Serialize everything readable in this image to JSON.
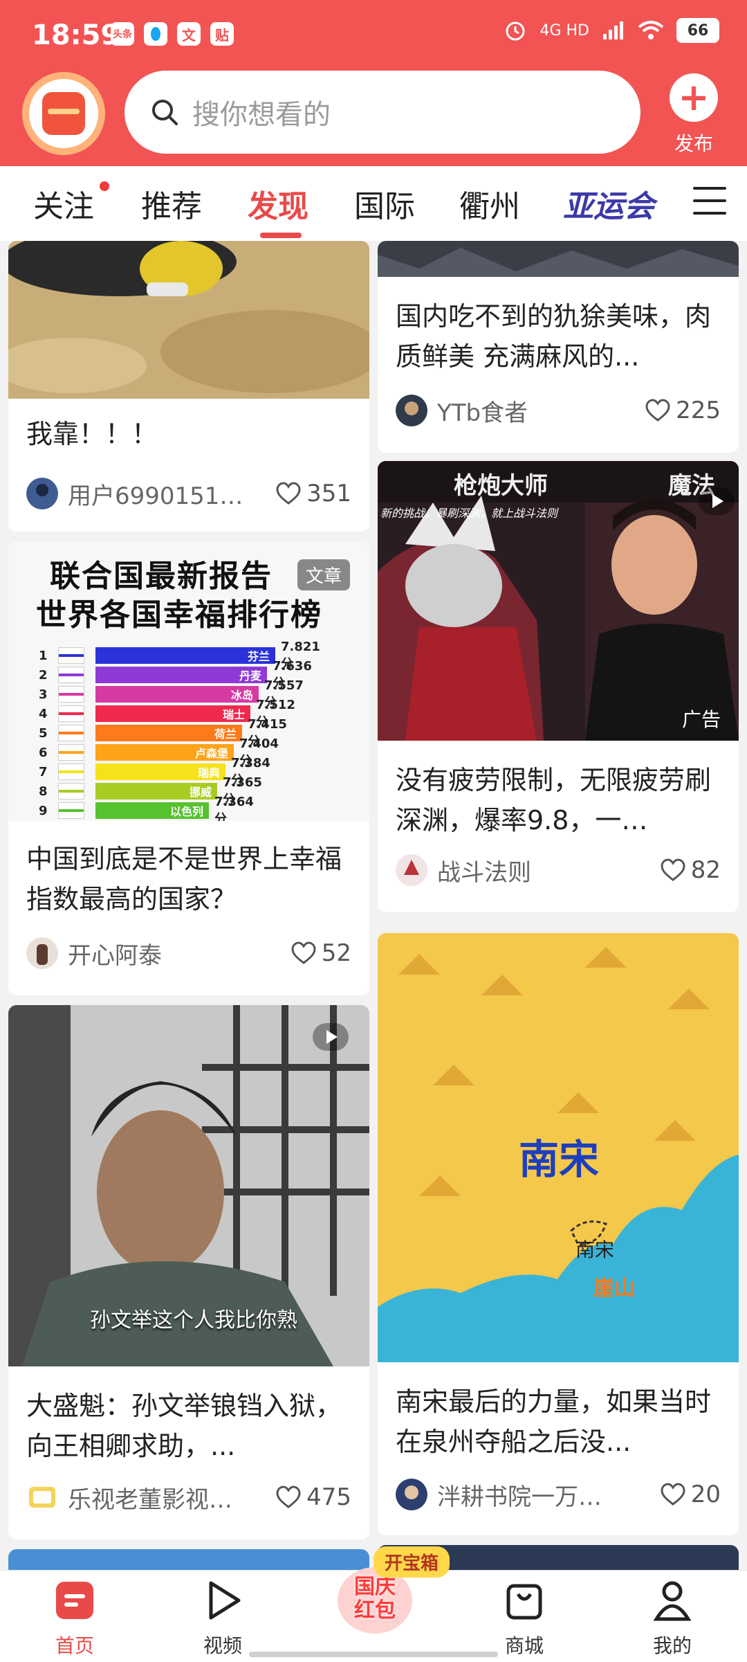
{
  "status_bar": {
    "time": "18:59",
    "apps": [
      "头条",
      "",
      "文",
      "贴"
    ],
    "network": "4G HD",
    "battery": "66"
  },
  "search": {
    "placeholder": "搜你想看的"
  },
  "publish_label": "发布",
  "tabs": [
    {
      "label": "关注"
    },
    {
      "label": "推荐"
    },
    {
      "label": "发现",
      "active": true
    },
    {
      "label": "国际"
    },
    {
      "label": "衢州"
    },
    {
      "label": "亚运会"
    }
  ],
  "cards": {
    "c1": {
      "title": "我靠！！！",
      "author": "用户6990151…",
      "likes": "351"
    },
    "c2": {
      "title": "国内吃不到的犰狳美味，肉质鲜美 充满麻风的...",
      "author": "YTb食者",
      "likes": "225"
    },
    "c3": {
      "tag": "文章",
      "title": "中国到底是不是世界上幸福指数最高的国家？",
      "author": "开心阿泰",
      "likes": "52",
      "chart": {
        "title1": "联合国最新报告",
        "title2": "世界各国幸福排行榜",
        "rows": [
          {
            "rank": "1",
            "country": "芬兰",
            "score": "7.821分",
            "color": "#2b32d9"
          },
          {
            "rank": "2",
            "country": "丹麦",
            "score": "7.636分",
            "color": "#8e3ad6"
          },
          {
            "rank": "3",
            "country": "冰岛",
            "score": "7.557分",
            "color": "#d63aa2"
          },
          {
            "rank": "4",
            "country": "瑞士",
            "score": "7.512分",
            "color": "#f0294e"
          },
          {
            "rank": "5",
            "country": "荷兰",
            "score": "7.415分",
            "color": "#ff7a1a"
          },
          {
            "rank": "6",
            "country": "卢森堡",
            "score": "7.404分",
            "color": "#ffa318"
          },
          {
            "rank": "7",
            "country": "瑞典",
            "score": "7.384分",
            "color": "#f6e21a"
          },
          {
            "rank": "8",
            "country": "挪威",
            "score": "7.365分",
            "color": "#a8cc22"
          },
          {
            "rank": "9",
            "country": "以色列",
            "score": "7.364分",
            "color": "#56c22e"
          }
        ]
      }
    },
    "c4": {
      "title": "没有疲劳限制，无限疲劳刷深渊，爆率9.8，一…",
      "author": "战斗法则",
      "likes": "82",
      "ad": "广告",
      "banner_left": "枪炮大师",
      "banner_right": "魔法",
      "banner_sub": "新的挑战，暴刷深渊，就上战斗法则"
    },
    "c5": {
      "title": "大盛魁：孙文举锒铛入狱，向王相卿求助，...",
      "author": "乐视老董影视…",
      "likes": "475",
      "subtitle": "孙文举这个人我比你熟"
    },
    "c6": {
      "title": "南宋最后的力量，如果当时在泉州夺船之后没...",
      "author": "泮耕书院一万…",
      "likes": "20",
      "map_big": "南宋",
      "map_small": "南宋",
      "map_orange": "崖山"
    }
  },
  "bottom_nav": {
    "home": "首页",
    "video": "视频",
    "promo_badge": "开宝箱",
    "promo_line1": "国庆",
    "promo_line2": "红包",
    "mall": "商城",
    "mine": "我的"
  },
  "colors": {
    "brand": "#f25454",
    "accent": "#e84a4a"
  }
}
